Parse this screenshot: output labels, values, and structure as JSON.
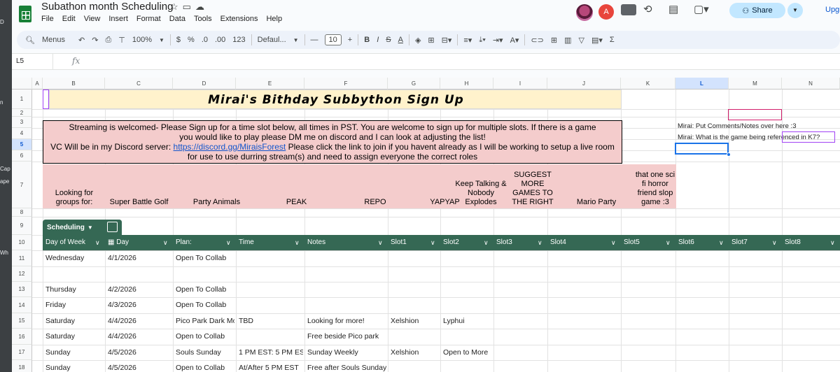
{
  "app": {
    "doc_title": "Subathon month Scheduling",
    "menus": [
      "File",
      "Edit",
      "View",
      "Insert",
      "Format",
      "Data",
      "Tools",
      "Extensions",
      "Help"
    ],
    "avatar_letter": "A",
    "share_label": "Share",
    "upgrade_label": "Upgrad",
    "brand_color": "#188038",
    "share_color": "#c2e7ff"
  },
  "toolbar": {
    "menus_label": "Menus",
    "zoom": "100%",
    "currency": "$",
    "percent": "%",
    "dec_decrease": ".0",
    "dec_increase": ".00",
    "number_format": "123",
    "font": "Defaul...",
    "font_size": "10",
    "minus": "—",
    "plus": "+",
    "bold": "B",
    "italic": "I",
    "strike": "S",
    "text_color": "A"
  },
  "formula_bar": {
    "name_box": "L5",
    "fx": "fx"
  },
  "left_strip": [
    "D",
    "n",
    "Cap",
    "ape",
    "Wh"
  ],
  "grid": {
    "columns": [
      "A",
      "B",
      "C",
      "D",
      "E",
      "F",
      "G",
      "H",
      "I",
      "J",
      "K",
      "L",
      "M",
      "N"
    ],
    "selected_column": "L",
    "rows": [
      "1",
      "2",
      "3",
      "4",
      "5",
      "6",
      "7",
      "8",
      "9",
      "10",
      "11",
      "12",
      "13",
      "14",
      "15",
      "16",
      "17",
      "18"
    ],
    "selected_row": "5"
  },
  "sheet": {
    "title": "Mirai's Bithday Subbython Sign Up",
    "info_line1": "Streaming is welcomed- Please Sign up for a time slot below, all times in PST. You are welcome to sign up for multiple slots. If there is a game",
    "info_line2": "you would like to play please DM me on discord and I can look at adjusting the list!",
    "info_line3_pre": "VC Will be in my Discord server: ",
    "info_link": "https://discord.gg/MiraisForest",
    "info_line3_post": " Please click the link to join if you havent already as I will be working to setup a live room",
    "info_line4": "for use to use durring stream(s) and need to assign everyone the correct roles",
    "games": [
      "Looking for groups for:",
      "Super Battle Golf",
      "Party Animals",
      "PEAK",
      "REPO",
      "YAPYAP",
      "Keep Talking & Nobody Explodes",
      "SUGGEST MORE GAMES TO THE RIGHT",
      "Mario Party",
      "that one sci fi horror friend slop game :3"
    ],
    "comment1": "Mirai: Put Comments/Notes over here :3",
    "comment2": "Mirai: What is the game being referenced in K7?",
    "pink_color": "#f4cccc",
    "banner_color": "#fff2cc"
  },
  "table": {
    "name": "Scheduling",
    "header_color": "#356854",
    "headers": [
      "Day of Week",
      "Day",
      "Plan:",
      "Time",
      "Notes",
      "Slot1",
      "Slot2",
      "Slot3",
      "Slot4",
      "Slot5",
      "Slot6",
      "Slot7",
      "Slot8"
    ],
    "rows": [
      {
        "row": "11",
        "dow": "Wednesday",
        "day": "4/1/2026",
        "plan": "Open To Collab",
        "time": "",
        "notes": "",
        "slot1": "",
        "slot2": ""
      },
      {
        "row": "12",
        "dow": "",
        "day": "",
        "plan": "",
        "time": "",
        "notes": "",
        "slot1": "",
        "slot2": ""
      },
      {
        "row": "13",
        "dow": "Thursday",
        "day": "4/2/2026",
        "plan": "Open To Collab",
        "time": "",
        "notes": "",
        "slot1": "",
        "slot2": ""
      },
      {
        "row": "14",
        "dow": "Friday",
        "day": "4/3/2026",
        "plan": "Open To Collab",
        "time": "",
        "notes": "",
        "slot1": "",
        "slot2": ""
      },
      {
        "row": "15",
        "dow": "Saturday",
        "day": "4/4/2026",
        "plan": "Pico Park Dark Mode",
        "time": "TBD",
        "notes": "Looking for more!",
        "slot1": "Xelshion",
        "slot2": "Lyphui"
      },
      {
        "row": "16",
        "dow": "Saturday",
        "day": "4/4/2026",
        "plan": "Open to Collab",
        "time": "",
        "notes": "Free beside Pico park",
        "slot1": "",
        "slot2": ""
      },
      {
        "row": "17",
        "dow": "Sunday",
        "day": "4/5/2026",
        "plan": "Souls Sunday",
        "time": "1 PM EST: 5 PM EST",
        "notes": "Sunday Weekly",
        "slot1": "Xelshion",
        "slot2": "Open to More"
      },
      {
        "row": "18",
        "dow": "Sunday",
        "day": "4/5/2026",
        "plan": "Open to Collab",
        "time": "At/After 5 PM EST",
        "notes": "Free after Souls Sunday",
        "slot1": "",
        "slot2": ""
      }
    ]
  }
}
